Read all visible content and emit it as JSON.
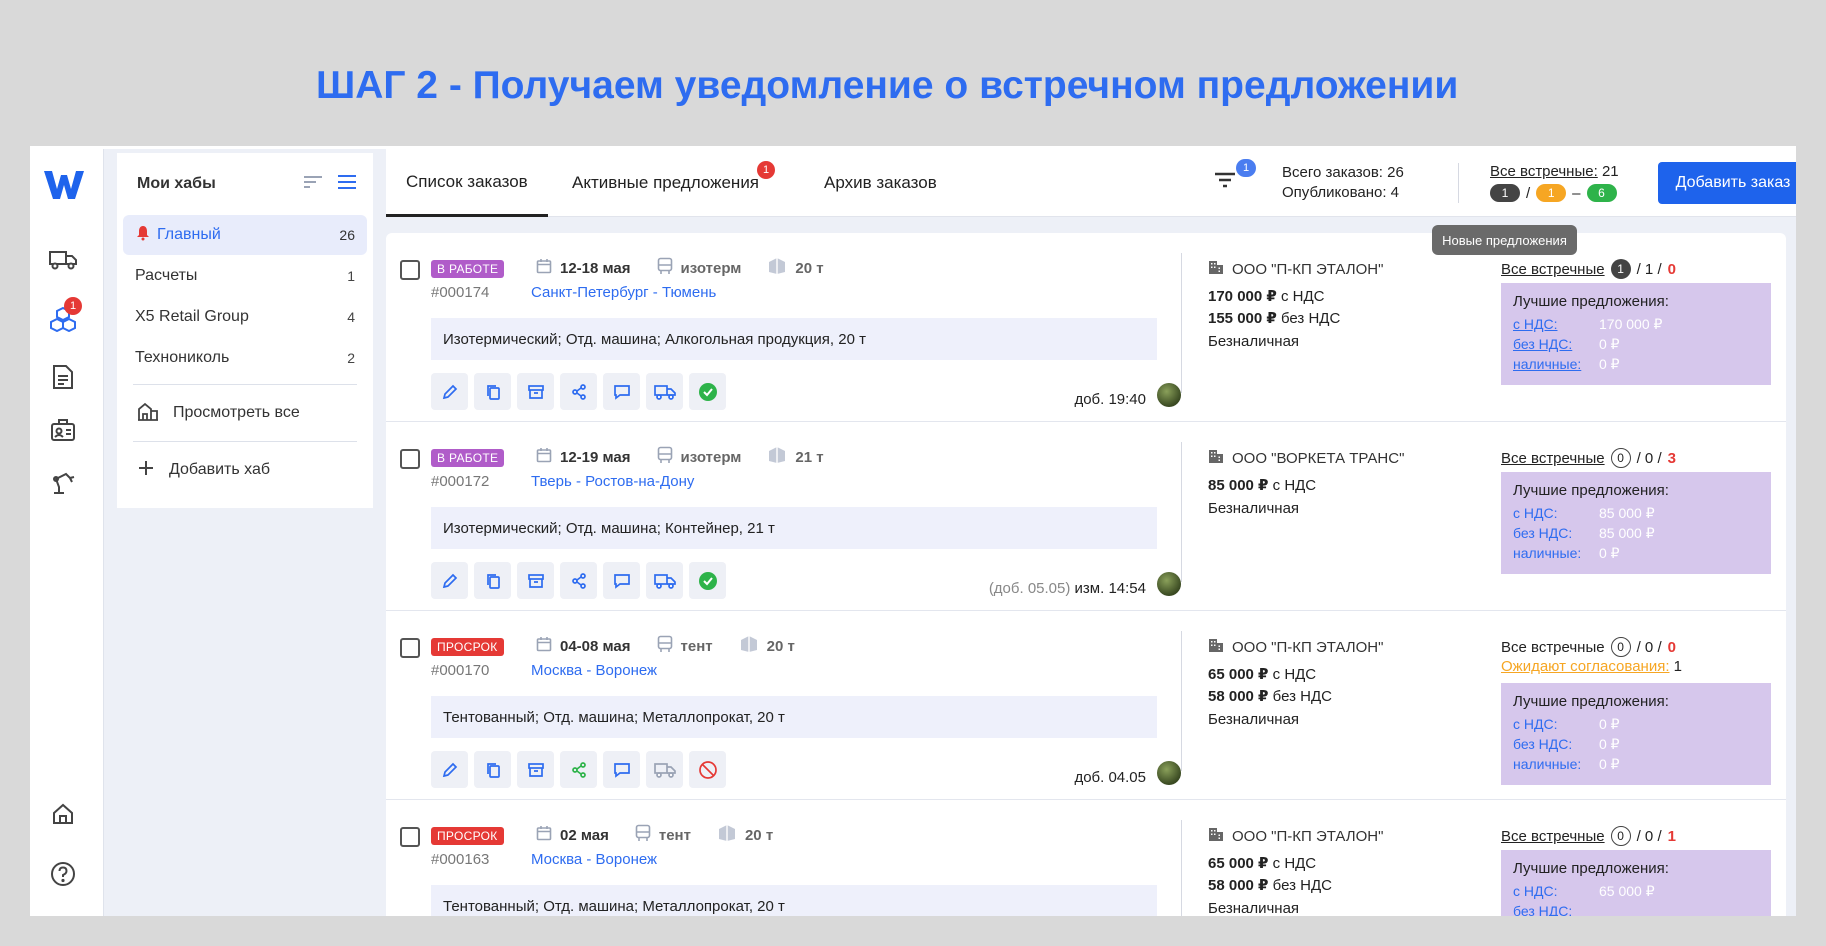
{
  "headline": "ШАГ 2 - Получаем уведомление о встречном предложении",
  "rail": {
    "logo": "W",
    "badge": "1"
  },
  "hubs": {
    "title": "Мои хабы",
    "items": [
      {
        "label": "Главный",
        "count": "26",
        "active": true
      },
      {
        "label": "Расчеты",
        "count": "1"
      },
      {
        "label": "X5 Retail Group",
        "count": "4"
      },
      {
        "label": "Технониколь",
        "count": "2"
      }
    ],
    "view_all": "Просмотреть все",
    "add_hub": "Добавить хаб"
  },
  "tabs": [
    {
      "label": "Список заказов"
    },
    {
      "label": "Активные предложения",
      "badge": "1"
    },
    {
      "label": "Архив заказов"
    }
  ],
  "filter_badge": "1",
  "stats": {
    "total": "Всего заказов: 26",
    "published": "Опубликовано: 4"
  },
  "all_counter": {
    "label": "Все встречные:",
    "value": "21",
    "pill1": "1",
    "sep": "/",
    "pill2": "1",
    "dash": "–",
    "pill3": "6"
  },
  "add_button": "Добавить заказ",
  "tooltip": "Новые предложения",
  "orders": [
    {
      "status": "В РАБОТЕ",
      "dates": "12-18 мая",
      "body": "изотерм",
      "weight": "20 т",
      "number": "#000174",
      "route": "Санкт-Петербург - Тюмень",
      "desc": "Изотермический; Отд. машина; Алкогольная продукция, 20 т",
      "added_gray": "",
      "added": "доб. 19:40",
      "company": "ООО \"П-КП ЭТАЛОН\"",
      "price1_val": "170 000 ₽",
      "price1_suf": " с НДС",
      "price2_val": "155 000 ₽",
      "price2_suf": " без НДС",
      "payment": "Безналичная",
      "counter_label": "Все встречные",
      "c1": "1",
      "c2": "/ 1 /",
      "c3": "0",
      "best_title": "Лучшие предложения:",
      "best": [
        {
          "k": "с НДС:",
          "v": "170 000 ₽"
        },
        {
          "k": "без НДС:",
          "v": "0 ₽"
        },
        {
          "k": "наличные:",
          "v": "0 ₽"
        }
      ]
    },
    {
      "status": "В РАБОТЕ",
      "dates": "12-19 мая",
      "body": "изотерм",
      "weight": "21 т",
      "number": "#000172",
      "route": "Тверь - Ростов-на-Дону",
      "desc": "Изотермический; Отд. машина; Контейнер, 21 т",
      "added_gray": "(доб. 05.05)",
      "added": "изм. 14:54",
      "company": "ООО \"ВОРКЕТА ТРАНС\"",
      "price1_val": "85 000 ₽",
      "price1_suf": " с НДС",
      "payment": "Безналичная",
      "counter_label": "Все встречные",
      "c1": "0",
      "c2": "/ 0 /",
      "c3": "3",
      "best_title": "Лучшие предложения:",
      "best": [
        {
          "k": "с НДС:",
          "v": "85 000 ₽"
        },
        {
          "k": "без НДС:",
          "v": "85 000 ₽"
        },
        {
          "k": "наличные:",
          "v": "0 ₽"
        }
      ]
    },
    {
      "status": "ПРОСРОК",
      "dates": "04-08 мая",
      "body": "тент",
      "weight": "20 т",
      "number": "#000170",
      "route": "Москва - Воронеж",
      "desc": "Тентованный; Отд. машина; Металлопрокат, 20 т",
      "added_gray": "",
      "added": "доб. 04.05",
      "company": "ООО \"П-КП ЭТАЛОН\"",
      "price1_val": "65 000 ₽",
      "price1_suf": " с НДС",
      "price2_val": "58 000 ₽",
      "price2_suf": " без НДС",
      "payment": "Безналичная",
      "counter_label": "Все встречные",
      "c1": "0",
      "c2": "/ 0 /",
      "c3": "0",
      "waiting_label": "Ожидают согласования:",
      "waiting_val": " 1",
      "best_title": "Лучшие предложения:",
      "best": [
        {
          "k": "с НДС:",
          "v": "0 ₽"
        },
        {
          "k": "без НДС:",
          "v": "0 ₽"
        },
        {
          "k": "наличные:",
          "v": "0 ₽"
        }
      ]
    },
    {
      "status": "ПРОСРОК",
      "dates": "02 мая",
      "body": "тент",
      "weight": "20 т",
      "number": "#000163",
      "route": "Москва - Воронеж",
      "desc": "Тентованный; Отд. машина; Металлопрокат, 20 т",
      "added_gray": "",
      "added": "",
      "company": "ООО \"П-КП ЭТАЛОН\"",
      "price1_val": "65 000 ₽",
      "price1_suf": " с НДС",
      "price2_val": "58 000 ₽",
      "price2_suf": " без НДС",
      "payment": "Безналичная",
      "counter_label": "Все встречные",
      "c1": "0",
      "c2": "/ 0 /",
      "c3": "1",
      "best_title": "Лучшие предложения:",
      "best": [
        {
          "k": "с НДС:",
          "v": "65 000 ₽"
        },
        {
          "k": "без НДС:",
          "v": ""
        }
      ]
    }
  ]
}
